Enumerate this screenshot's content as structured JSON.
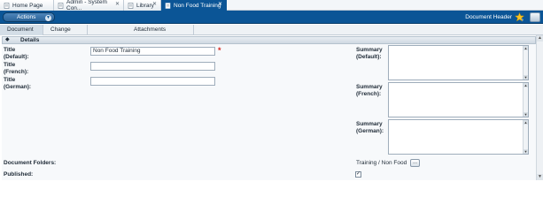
{
  "tabs": [
    {
      "label": "Home Page",
      "active": false
    },
    {
      "label": "Admin - System Con...",
      "active": false
    },
    {
      "label": "Library",
      "active": false
    },
    {
      "label": "Non Food Training",
      "active": true
    }
  ],
  "header": {
    "actions_label": "Actions",
    "document_header_label": "Document Header"
  },
  "subtabs": [
    {
      "label": "Document Details",
      "active": true
    },
    {
      "label": "Change History",
      "active": false
    },
    {
      "label": "Attachments",
      "active": false
    }
  ],
  "section": {
    "title": "Details"
  },
  "form": {
    "title_default_label": "Title\n(Default):",
    "title_default_value": "Non Food Training",
    "required_mark": "*",
    "title_french_label": "Title\n(French):",
    "title_french_value": "",
    "title_german_label": "Title\n(German):",
    "title_german_value": "",
    "summary_default_label": "Summary\n(Default):",
    "summary_french_label": "Summary\n(French):",
    "summary_german_label": "Summary\n(German):",
    "document_folders_label": "Document Folders:",
    "document_folders_value": "Training / Non Food",
    "browse_label": "...",
    "published_label": "Published:",
    "published_checked": true
  },
  "colors": {
    "accent": "#0b5596",
    "required": "#d8261f"
  }
}
